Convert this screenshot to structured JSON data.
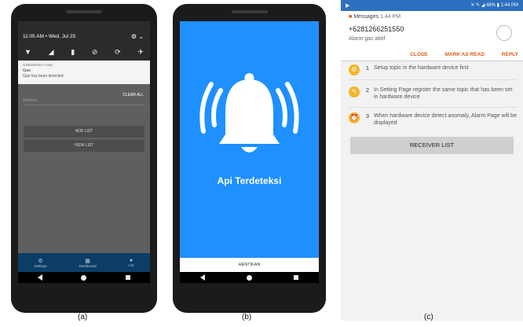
{
  "phone_a": {
    "status_time": "11:05 AM • Wed, Jul 25",
    "notification": {
      "app": "GasDetector • now",
      "title": "Gas",
      "body": "Gas has been detected"
    },
    "clear_all": "CLEAR ALL",
    "address_placeholder": "Address",
    "add_list": "ADD LIST",
    "view_list": "VIEW LIST",
    "tabs": [
      {
        "label": "Settings"
      },
      {
        "label": "Dashboard"
      },
      {
        "label": "List"
      }
    ]
  },
  "phone_b": {
    "title": "Api Terdeteksi",
    "button": "HENTIKAN",
    "bg_color": "#1e90ff"
  },
  "screen_c": {
    "status_time": "1:44 PM",
    "battery": "48%",
    "message": {
      "app": "Messages",
      "time": "1:44 PM",
      "sender": "+6281266251550",
      "body": "Alarm gas aktif",
      "actions": [
        "CLOSE",
        "MARK AS READ",
        "REPLY"
      ]
    },
    "steps": [
      {
        "num": "1",
        "text": "Setup topic in the hardware device first"
      },
      {
        "num": "2",
        "text": "In Setting Page register the same topic that has been set in hardware device"
      },
      {
        "num": "3",
        "text": "When hardware device detect anomaly, Alarm Page will be displayed"
      }
    ],
    "receiver_button": "RECEIVER LIST"
  },
  "captions": [
    "(a)",
    "(b)",
    "(c)"
  ]
}
